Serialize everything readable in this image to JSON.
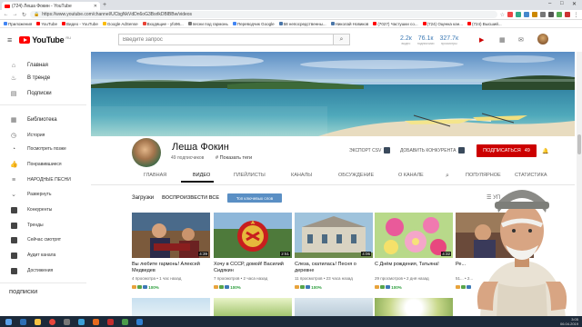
{
  "browser": {
    "tab_title": "(724) Леша Фокин - YouTube",
    "url": "https://www.youtube.com/channel/UCbgNkVdDn6oG3BsrlkDBlBBw/videos",
    "bookmarks": [
      {
        "label": "Приложения",
        "color": "#4285f4"
      },
      {
        "label": "YouTube",
        "color": "#ff0000"
      },
      {
        "label": "Видео - YouTube",
        "color": "#ff0000"
      },
      {
        "label": "Google AdSense",
        "color": "#fbbc05"
      },
      {
        "label": "Входящие - yfo96...",
        "color": "#ea4335"
      },
      {
        "label": "песни под гармонь",
        "color": "#777777"
      },
      {
        "label": "Переводчик Google",
        "color": "#4285f4"
      },
      {
        "label": "58 непосредственны...",
        "color": "#4a76a8"
      },
      {
        "label": "Николай Новиков",
        "color": "#4a76a8"
      },
      {
        "label": "(7027) Частушки со...",
        "color": "#ff0000"
      },
      {
        "label": "(724) Оценка кан...",
        "color": "#ff0000"
      },
      {
        "label": "(724) Высший...",
        "color": "#ff0000"
      }
    ]
  },
  "header": {
    "logo_text": "YouTube",
    "logo_suffix": "RU",
    "search_placeholder": "Введите запрос",
    "stats": [
      {
        "value": "2.2к",
        "label": "видео"
      },
      {
        "value": "76.1к",
        "label": "подписчики"
      },
      {
        "value": "327.7к",
        "label": "просмотры"
      }
    ]
  },
  "sidebar": {
    "top": [
      {
        "label": "Главная",
        "icon": "home-icon",
        "glyph": "⌂"
      },
      {
        "label": "В тренде",
        "icon": "fire-icon",
        "glyph": "♨"
      },
      {
        "label": "Подписки",
        "icon": "subscriptions-icon",
        "glyph": "▤"
      }
    ],
    "library": [
      {
        "label": "Библиотека",
        "icon": "library-icon",
        "glyph": "▦"
      },
      {
        "label": "История",
        "icon": "history-icon",
        "glyph": "◷"
      },
      {
        "label": "Посмотреть позже",
        "icon": "watch-later-icon",
        "glyph": "◔"
      },
      {
        "label": "Понравившиеся",
        "icon": "like-icon",
        "glyph": "👍"
      },
      {
        "label": "НАРОДНЫЕ ПЕСНИ",
        "icon": "playlist-icon",
        "glyph": "≡"
      },
      {
        "label": "Развернуть",
        "icon": "chevron-down-icon",
        "glyph": "⌄"
      }
    ],
    "playlists": [
      {
        "label": "Конкуренты"
      },
      {
        "label": "Тренды"
      },
      {
        "label": "Сейчас смотрят"
      },
      {
        "label": "Аудит канала"
      },
      {
        "label": "Достижения"
      }
    ],
    "section_subscriptions": "ПОДПИСКИ"
  },
  "channel": {
    "name": "Леша Фокин",
    "subscribers": "49 подписчиков",
    "tags_link": "Показать теги",
    "export_csv": "ЭКСПОРТ CSV",
    "add_competitor": "ДОБАВИТЬ КОНКУРЕНТА",
    "subscribe_label": "ПОДПИСАТЬСЯ",
    "subscribe_count": "49"
  },
  "tabs": [
    "ГЛАВНАЯ",
    "ВИДЕО",
    "ПЛЕЙЛИСТЫ",
    "КАНАЛЫ",
    "ОБСУЖДЕНИЕ",
    "О КАНАЛЕ",
    "ПОПУЛЯРНОЕ",
    "СТАТИСТИКА"
  ],
  "uploads": {
    "title": "Загрузки",
    "play_all": "ВОСПРОИЗВЕСТИ ВСЕ",
    "tag_cloud_button": "Топ ключевых слов",
    "sort_label": "УП"
  },
  "videos": [
    {
      "title": "Вы любите гармонь! Алексей Медведев",
      "views": "4 просмотра",
      "age": "1 час назад",
      "score": "100%",
      "duration": "4:39"
    },
    {
      "title": "Хочу в СССР, домой! Василий Сидякин",
      "views": "7 просмотров",
      "age": "2 часа назад",
      "score": "100%",
      "duration": "2:51"
    },
    {
      "title": "Слеза, скатилась! Песня о деревне",
      "views": "11 просмотров",
      "age": "23 часа назад",
      "score": "100%",
      "duration": "4:06"
    },
    {
      "title": "С Днём рождения, Татьяна!",
      "views": "29 просмотров",
      "age": "2 дня назад",
      "score": "100%",
      "duration": "4:32"
    },
    {
      "title": "Ре...",
      "views": "51...",
      "age": "2...",
      "score": "",
      "duration": ""
    }
  ],
  "taskbar": {
    "time": "3:05",
    "date": "06.04.2019"
  },
  "colors": {
    "brand_red": "#ff0000",
    "subscribe_red": "#cc0000",
    "stat_blue": "#3d7ab5",
    "tag_button_blue": "#5a8fc4"
  }
}
